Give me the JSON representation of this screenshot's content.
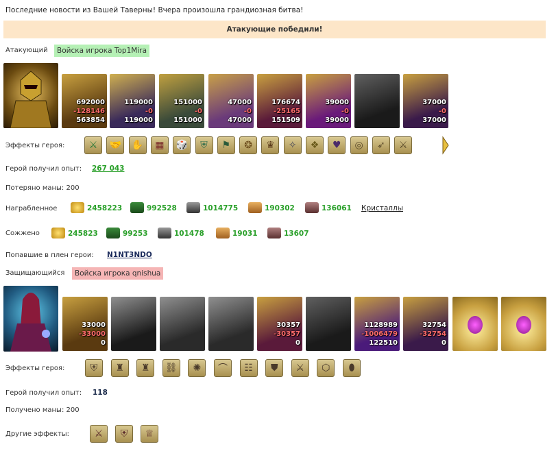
{
  "news": "Последние новости из Вашей Таверны! Вчера произошла грандиозная битва!",
  "banner": "Атакующие победили!",
  "attacker": {
    "label": "Атакующий",
    "army": "Войска игрока Top1Mira",
    "units": [
      {
        "n1": "692000",
        "n2": "-128146",
        "n3": "563854"
      },
      {
        "n1": "119000",
        "n2": "-0",
        "n3": "119000"
      },
      {
        "n1": "151000",
        "n2": "-0",
        "n3": "151000"
      },
      {
        "n1": "47000",
        "n2": "-0",
        "n3": "47000"
      },
      {
        "n1": "176674",
        "n2": "-25165",
        "n3": "151509"
      },
      {
        "n1": "39000",
        "n2": "-0",
        "n3": "39000"
      },
      {
        "n1": "",
        "n2": "",
        "n3": ""
      },
      {
        "n1": "37000",
        "n2": "-0",
        "n3": "37000"
      }
    ],
    "effects_label": "Эффекты героя:",
    "exp_label": "Герой получил опыт:",
    "exp_value": "267 043",
    "mana_label": "Потеряно маны: 200",
    "loot_label": "Награбленное",
    "loot": [
      "2458223",
      "992528",
      "1014775",
      "190302",
      "136061"
    ],
    "loot_link": "Кристаллы",
    "burned_label": "Сожжено",
    "burned": [
      "245823",
      "99253",
      "101478",
      "19031",
      "13607"
    ],
    "captured_label": "Попавшие в плен герои:",
    "captured_value": "N1NT3NDO"
  },
  "defender": {
    "label": "Защищающийся",
    "army": "Войска игрока qnishua",
    "units": [
      {
        "n1": "33000",
        "n2": "-33000",
        "n3": "0"
      },
      {
        "n1": "",
        "n2": "",
        "n3": ""
      },
      {
        "n1": "",
        "n2": "",
        "n3": ""
      },
      {
        "n1": "",
        "n2": "",
        "n3": ""
      },
      {
        "n1": "30357",
        "n2": "-30357",
        "n3": "0"
      },
      {
        "n1": "",
        "n2": "",
        "n3": ""
      },
      {
        "n1": "1128989",
        "n2": "-1006479",
        "n3": "122510"
      },
      {
        "n1": "32754",
        "n2": "-32754",
        "n3": "0"
      },
      {
        "n1": "",
        "n2": "",
        "n3": ""
      },
      {
        "n1": "",
        "n2": "",
        "n3": ""
      }
    ],
    "effects_label": "Эффекты героя:",
    "exp_label": "Герой получил опыт:",
    "exp_value": "118",
    "mana_label": "Получено маны: 200",
    "other_label": "Другие эффекты:"
  },
  "colors": {
    "gain": "#2aa02a",
    "loss": "#ff6b6b",
    "banner": "#fde6c8"
  }
}
